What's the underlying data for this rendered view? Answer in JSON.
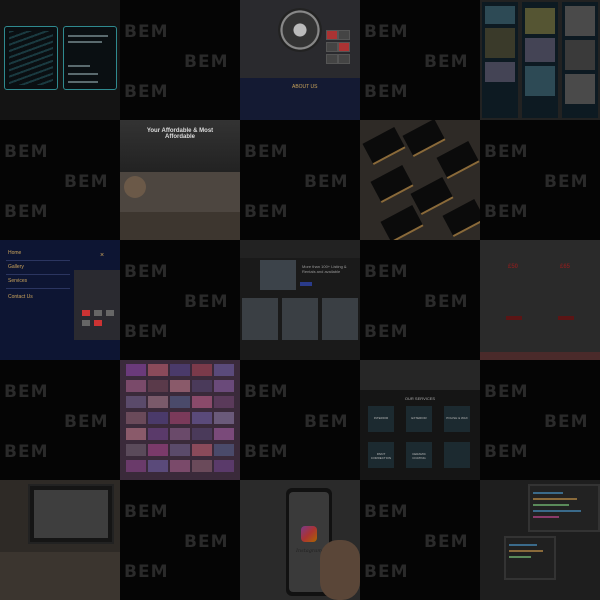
{
  "watermark": "BEM",
  "tiles": [
    {
      "id": 1,
      "kind": "business-cards-teal"
    },
    {
      "id": 2,
      "kind": "watermark-only"
    },
    {
      "id": 3,
      "kind": "dj-controller-site",
      "caption": "ABOUT US"
    },
    {
      "id": 4,
      "kind": "watermark-only"
    },
    {
      "id": 5,
      "kind": "dark-site-screens"
    },
    {
      "id": 6,
      "kind": "watermark-only"
    },
    {
      "id": 7,
      "kind": "photography-site",
      "headline": "Your Affordable & Most Affordable"
    },
    {
      "id": 8,
      "kind": "watermark-only"
    },
    {
      "id": 9,
      "kind": "black-gold-business-cards"
    },
    {
      "id": 10,
      "kind": "watermark-only"
    },
    {
      "id": 11,
      "kind": "mobile-menu",
      "menu": [
        "Home",
        "Gallery",
        "Services",
        "Contact Us"
      ],
      "close": "×"
    },
    {
      "id": 12,
      "kind": "watermark-only"
    },
    {
      "id": 13,
      "kind": "car-rental-site",
      "headline": "More than 100+ Listing & Rentals and available"
    },
    {
      "id": 14,
      "kind": "watermark-only"
    },
    {
      "id": 15,
      "kind": "pricing-page",
      "prices": [
        "£50",
        "£65"
      ],
      "footer_text": "Standard valet services"
    },
    {
      "id": 16,
      "kind": "watermark-only"
    },
    {
      "id": 17,
      "kind": "wedding-gallery"
    },
    {
      "id": 18,
      "kind": "watermark-only"
    },
    {
      "id": 19,
      "kind": "detailing-services",
      "heading": "OUR SERVICES",
      "services": [
        "INTERIOR",
        "EXTERIOR",
        "POLISH & WAX",
        "PAINT CORRECTION",
        "CERAMIC COATING",
        ""
      ]
    },
    {
      "id": 20,
      "kind": "watermark-only"
    },
    {
      "id": 21,
      "kind": "designer-desk-monitor"
    },
    {
      "id": 22,
      "kind": "watermark-only"
    },
    {
      "id": 23,
      "kind": "phone-instagram",
      "app_name": "Instagram"
    },
    {
      "id": 24,
      "kind": "watermark-only"
    },
    {
      "id": 25,
      "kind": "laptops-code"
    }
  ],
  "colors": {
    "background": "#000000",
    "watermark": "#2a2a2a",
    "teal": "#2f8a8f",
    "gold": "#caa35c",
    "navy": "#0d1533"
  }
}
